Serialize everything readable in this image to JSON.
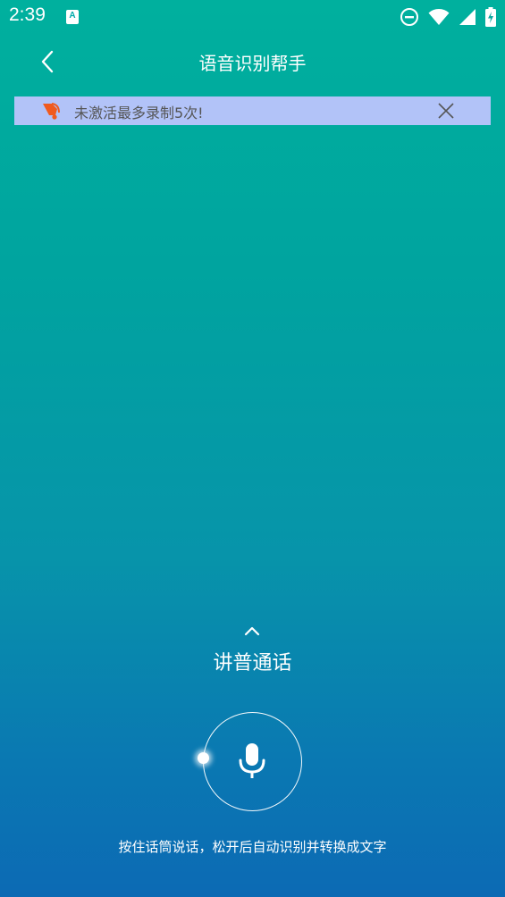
{
  "status_bar": {
    "time": "2:39",
    "app_icon_letter": "A",
    "icons": [
      "do-not-disturb-icon",
      "wifi-icon",
      "signal-icon",
      "battery-charging-icon"
    ]
  },
  "header": {
    "title": "语音识别帮手",
    "back_icon": "chevron-left-icon"
  },
  "notice": {
    "text": "未激活最多录制5次!",
    "icon": "bell-icon",
    "close_icon": "close-icon",
    "background": "#B2C3F8",
    "icon_color": "#F05A1E"
  },
  "mode": {
    "label": "讲普通话",
    "chevron_icon": "chevron-up-icon"
  },
  "mic": {
    "icon": "microphone-icon"
  },
  "hint": {
    "text": "按住话筒说话，松开后自动识别并转换成文字"
  },
  "colors": {
    "gradient_top": "#00B09E",
    "gradient_bottom": "#0C6AB4",
    "text": "#FFFFFF"
  }
}
